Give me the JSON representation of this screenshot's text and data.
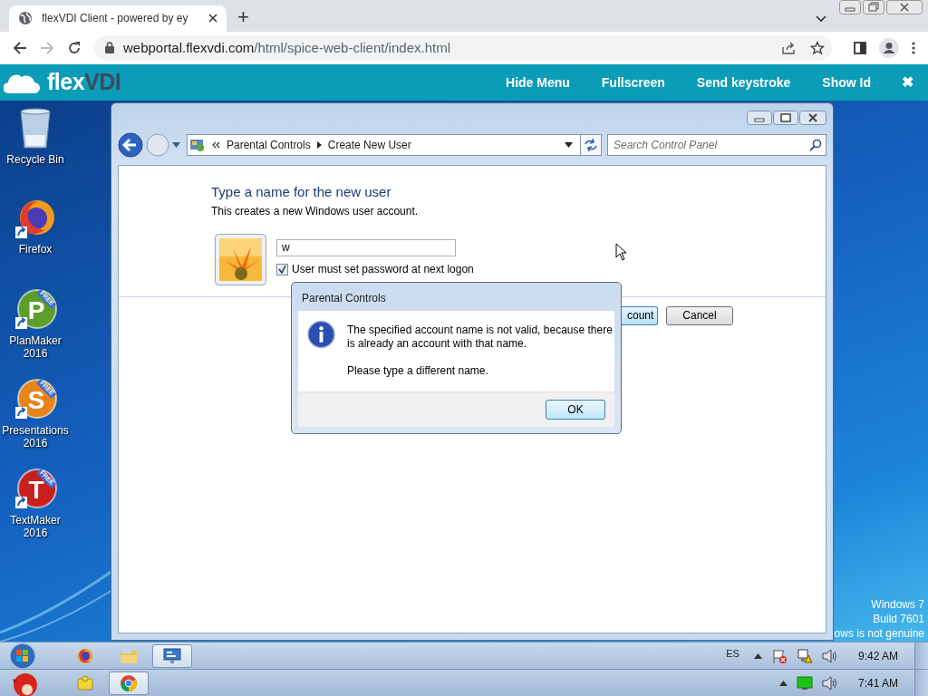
{
  "browser": {
    "tab": {
      "title": "flexVDI Client - powered by ey",
      "selected": true
    },
    "new_tab": "+",
    "url_host": "webportal.flexvdi.com",
    "url_path": "/html/spice-web-client/index.html"
  },
  "toolbar": {
    "logo": [
      "flex",
      "VDI"
    ],
    "menu": [
      "Hide Menu",
      "Fullscreen",
      "Send keystroke",
      "Show Id"
    ],
    "close": "✖"
  },
  "desktop": {
    "icons": [
      {
        "label": [
          "Recycle Bin"
        ],
        "kind": "bin"
      },
      {
        "label": [
          "Firefox"
        ],
        "kind": "firefox"
      },
      {
        "label": [
          "PlanMaker",
          "2016"
        ],
        "kind": "office",
        "letter": "P",
        "badge": "FREE",
        "color": "#5c9e2a"
      },
      {
        "label": [
          "Presentations",
          "2016"
        ],
        "kind": "office",
        "letter": "S",
        "badge": "FREE",
        "color": "#e8851a"
      },
      {
        "label": [
          "TextMaker",
          "2016"
        ],
        "kind": "office",
        "letter": "T",
        "badge": "FREE",
        "color": "#c8201e"
      }
    ],
    "watermark": [
      "Windows 7",
      "Build 7601",
      "ows is not genuine"
    ]
  },
  "window": {
    "breadcrumb": [
      "Parental Controls",
      "Create New User"
    ],
    "search": {
      "placeholder": "Search Control Panel"
    },
    "heading": "Type a name for the new user",
    "description": "This creates a new Windows user account.",
    "name_field": {
      "value": "w"
    },
    "password_checkbox": {
      "label": "User must set password at next logon",
      "checked": true
    },
    "buttons": [
      {
        "label": "count",
        "kind": "primary"
      },
      {
        "label": "Cancel",
        "kind": "normal"
      }
    ]
  },
  "dialog": {
    "title": "Parental Controls",
    "message": "The specified account name is not valid, because there is already an account with that name.",
    "hint": "Please type a different name.",
    "button": "OK"
  },
  "taskbar": {
    "items": [
      {
        "kind": "firefox",
        "selected": false
      },
      {
        "kind": "explorer",
        "selected": false
      },
      {
        "kind": "control-panel",
        "selected": true
      }
    ],
    "language": "ES",
    "clock": "9:42 AM"
  },
  "host_taskbar": {
    "items": [
      {
        "kind": "folder",
        "selected": false
      },
      {
        "kind": "chrome",
        "selected": true
      }
    ],
    "clock": "7:41 AM"
  }
}
